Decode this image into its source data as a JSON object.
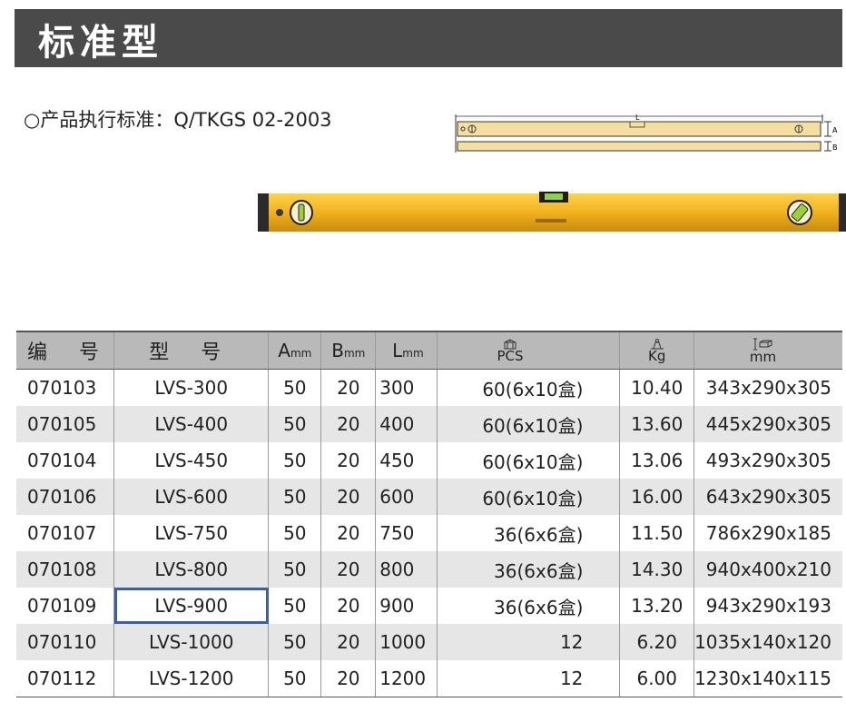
{
  "header": {
    "title": "标准型"
  },
  "standard": {
    "text": "○产品执行标准：Q/TKGS 02-2003"
  },
  "diagram": {
    "labels": {
      "length": "L",
      "height_a": "A",
      "width_b": "B"
    }
  },
  "colors": {
    "header_bg": "#4a4a4a",
    "level_yellow": "#f0b21c",
    "selection": "#3a5ea8"
  },
  "table": {
    "headers": {
      "code": "编 号",
      "model": "型 号",
      "a": {
        "letter": "A",
        "unit": "mm"
      },
      "b": {
        "letter": "B",
        "unit": "mm"
      },
      "l": {
        "letter": "L",
        "unit": "mm"
      },
      "pcs": {
        "icon": "carton-box-icon",
        "label": "PCS"
      },
      "kg": {
        "icon": "weight-icon",
        "label": "Kg"
      },
      "mm": {
        "icon": "carton-dimension-icon",
        "label": "mm"
      }
    },
    "rows": [
      {
        "code": "070103",
        "model": "LVS-300",
        "a": "50",
        "b": "20",
        "l": "300",
        "pcs": "60(6x10盒)",
        "kg": "10.40",
        "mm": "343x290x305"
      },
      {
        "code": "070105",
        "model": "LVS-400",
        "a": "50",
        "b": "20",
        "l": "400",
        "pcs": "60(6x10盒)",
        "kg": "13.60",
        "mm": "445x290x305"
      },
      {
        "code": "070104",
        "model": "LVS-450",
        "a": "50",
        "b": "20",
        "l": "450",
        "pcs": "60(6x10盒)",
        "kg": "13.06",
        "mm": "493x290x305"
      },
      {
        "code": "070106",
        "model": "LVS-600",
        "a": "50",
        "b": "20",
        "l": "600",
        "pcs": "60(6x10盒)",
        "kg": "16.00",
        "mm": "643x290x305"
      },
      {
        "code": "070107",
        "model": "LVS-750",
        "a": "50",
        "b": "20",
        "l": "750",
        "pcs": "36(6x6盒)",
        "kg": "11.50",
        "mm": "786x290x185"
      },
      {
        "code": "070108",
        "model": "LVS-800",
        "a": "50",
        "b": "20",
        "l": "800",
        "pcs": "36(6x6盒)",
        "kg": "14.30",
        "mm": "940x400x210"
      },
      {
        "code": "070109",
        "model": "LVS-900",
        "a": "50",
        "b": "20",
        "l": "900",
        "pcs": "36(6x6盒)",
        "kg": "13.20",
        "mm": "943x290x193"
      },
      {
        "code": "070110",
        "model": "LVS-1000",
        "a": "50",
        "b": "20",
        "l": "1000",
        "pcs": "12",
        "kg": "6.20",
        "mm": "1035x140x120"
      },
      {
        "code": "070112",
        "model": "LVS-1200",
        "a": "50",
        "b": "20",
        "l": "1200",
        "pcs": "12",
        "kg": "6.00",
        "mm": "1230x140x115"
      }
    ]
  }
}
